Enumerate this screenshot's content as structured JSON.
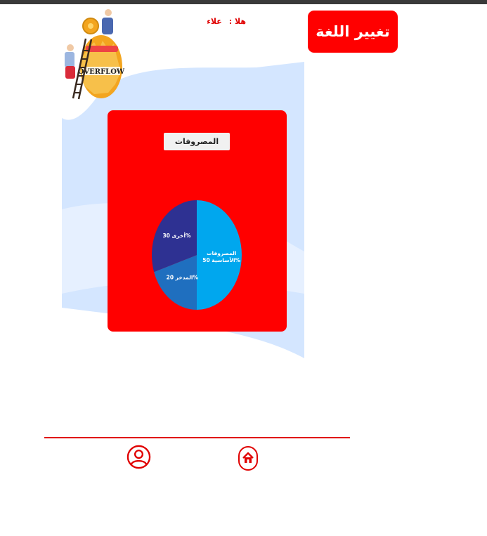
{
  "header": {
    "language_button_label": "تغيير اللغة",
    "greeting_label": "هلا :",
    "user_name": "علاء"
  },
  "logo": {
    "jar_text": "OVERFLOW"
  },
  "panel": {
    "title": "المصروفات"
  },
  "chart_data": {
    "type": "pie",
    "title": "",
    "slices": [
      {
        "label": "المصروفات الأساسية",
        "value": 50,
        "value_label": "50%",
        "color": "#00a7ee"
      },
      {
        "label": "المدخر",
        "value": 20,
        "value_label": "20%",
        "color": "#1f6fbf"
      },
      {
        "label": "أخرى",
        "value": 30,
        "value_label": "30%",
        "color": "#2e3192"
      }
    ]
  },
  "footer": {
    "icons": [
      "user-profile-icon",
      "home-icon"
    ]
  },
  "colors": {
    "accent": "#ff0000",
    "footer_line": "#e00000",
    "background_shape": "#cfe4ff",
    "topbar": "#3a3a3a"
  }
}
